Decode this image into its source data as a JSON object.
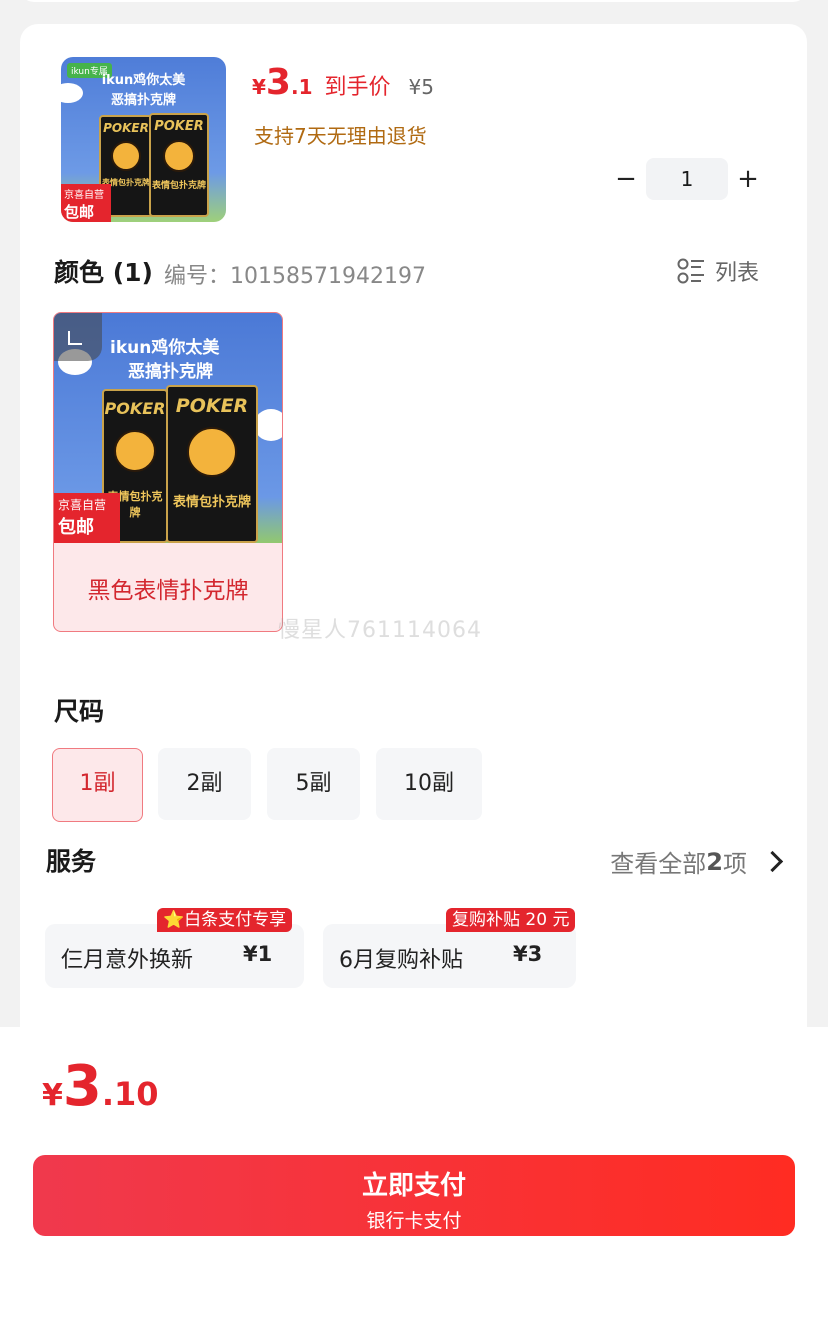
{
  "product": {
    "image_badge_brand": "ikun专属",
    "image_title_1": "ikun鸡你太美",
    "image_title_2": "恶搞扑克牌",
    "deck_title": "POKER",
    "deck_label": "表情包扑克牌",
    "image_badge_1": "京喜自营",
    "image_badge_2": "包邮",
    "price_currency": "¥",
    "price_int": "3",
    "price_dec": ".1",
    "price_tag": "到手价",
    "original_price": "¥5",
    "return_policy": "支持7天无理由退货",
    "quantity": "1",
    "minus": "−",
    "plus": "+"
  },
  "color_section": {
    "title": "颜色 (1)",
    "code": "编号：10158571942197",
    "list_toggle": "列表",
    "option": {
      "title_1": "ikun鸡你太美",
      "title_2": "恶搞扑克牌",
      "label": "黑色表情扑克牌",
      "badge_1": "京喜自营",
      "badge_2": "包邮"
    }
  },
  "watermark": "慢星人761114064",
  "size_section": {
    "title": "尺码",
    "options": [
      "1副",
      "2副",
      "5副",
      "10副"
    ],
    "selected": "1副"
  },
  "service_section": {
    "title": "服务",
    "view_all_prefix": "查看全部",
    "view_all_count": "2",
    "view_all_suffix": "项",
    "items": [
      {
        "name": "仨月意外换新",
        "price": "¥1",
        "tag": "⭐白条支付专享"
      },
      {
        "name": "6月复购补贴",
        "price": "¥3",
        "tag": "复购补贴 20 元"
      }
    ]
  },
  "footer": {
    "total_currency": "¥",
    "total_int": "3",
    "total_dec": ".10",
    "pay_label": "立即支付",
    "pay_method": "银行卡支付"
  },
  "colors": {
    "accent_red": "#e4252d",
    "return_brown": "#b06a12"
  }
}
